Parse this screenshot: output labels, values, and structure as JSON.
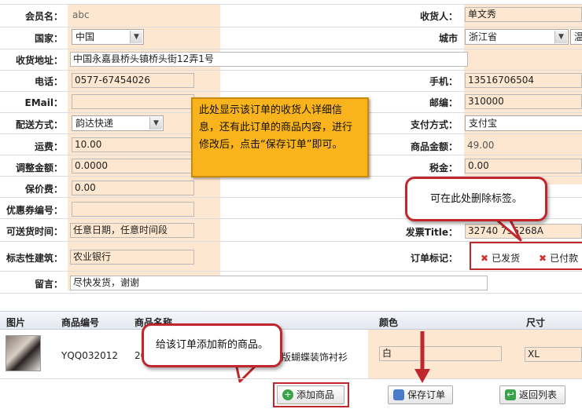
{
  "form": {
    "member_label": "会员名：",
    "member_value": "abc",
    "consignee_label": "收货人：",
    "consignee_value": "单文秀",
    "country_label": "国家：",
    "country_value": "中国",
    "city_label": "城市",
    "province_value": "浙江省",
    "city_value": "温",
    "address_label": "收货地址：",
    "address_value": "中国永嘉县桥头镇桥头街12弄1号",
    "phone_label": "电话：",
    "phone_value": "0577-67454026",
    "mobile_label": "手机：",
    "mobile_value": "13516706504",
    "email_label": "EMail：",
    "email_value": "",
    "zip_label": "邮编：",
    "zip_value": "310000",
    "shipping_label": "配送方式：",
    "shipping_value": "韵达快递",
    "payment_label": "支付方式：",
    "payment_value": "支付宝",
    "freight_label": "运费：",
    "freight_value": "10.00",
    "goods_amount_label": "商品金额：",
    "goods_amount_value": "49.00",
    "adjust_label": "调整金额：",
    "adjust_value": "0.0000",
    "tax_label": "税金：",
    "tax_value": "0.00",
    "insure_label": "保价费：",
    "insure_value": "0.00",
    "coupon_label": "优惠券编号：",
    "coupon_value": "",
    "delivery_time_label": "可送货时间：",
    "delivery_time_value": "任意日期，任意时间段",
    "invoice_label": "发票Title：",
    "invoice_value": "32740   736268A",
    "landmark_label": "标志性建筑：",
    "landmark_value": "农业银行",
    "order_tag_label": "订单标记：",
    "tag_shipped": "已发货",
    "tag_paid": "已付款",
    "message_label": "留言：",
    "message_value": "尽快发货，谢谢"
  },
  "callouts": {
    "info": "此处显示该订单的收货人详细信息，还有此订单的商品内容，进行修改后，点击“保存订单”即可。",
    "delete_tag": "可在此处删除标签。",
    "add_goods": "给该订单添加新的商品。"
  },
  "table": {
    "headers": [
      "图片",
      "商品编号",
      "商品名称",
      "颜色",
      "尺寸"
    ],
    "row": {
      "code": "YQQ032012",
      "name_start": "20",
      "name_end": "版蝴蝶装饰衬衫",
      "color": "白",
      "size": "XL"
    }
  },
  "buttons": {
    "add_goods": "添加商品",
    "save_order": "保存订单",
    "back_list": "返回列表"
  },
  "colors": {
    "highlight": "#fde7d0",
    "callout": "#f9b31c",
    "red": "#c0272d"
  }
}
